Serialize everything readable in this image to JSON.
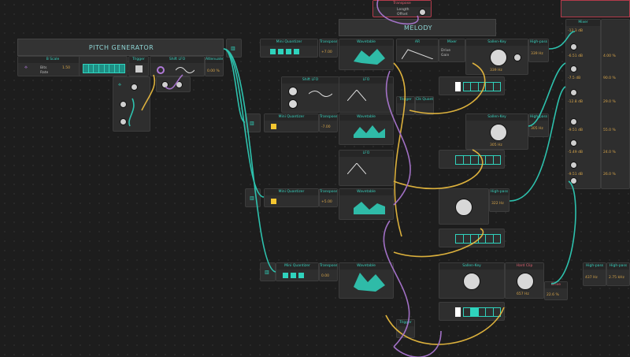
{
  "groups": {
    "pitch_generator": "PITCH GENERATOR",
    "melody": "MELODY"
  },
  "modules": {
    "bitrate": "B Scale",
    "trigger": "Trigger",
    "lfo_top": "Shift LFO",
    "attenuate": "Attenuate",
    "transpose_top": "Transpose",
    "transpose_red": "Transpose",
    "mini_quantizer": "Mini Quantizer",
    "transpose": "Transpose",
    "wavetable": "Wavetable",
    "ar": "AR",
    "mixer": "Mixer",
    "sallen_key": "Sallen-Key",
    "high_pass": "High-pass",
    "mixer_right": "Mixer",
    "hard_clip": "Hard Clip",
    "cb_quant": "Clk Quant",
    "trigger_small": "Trigger",
    "mod_lfo": "Shift LFO",
    "lfo": "LFO",
    "drive": "Drive",
    "comb": "Combo"
  },
  "labels": {
    "length": "Length",
    "offset": "Offset",
    "bits": "Bits",
    "rate": "Rate",
    "gain": "Gain",
    "drive": "Drive",
    "bipolar": "Bipolar",
    "sine": "Sine"
  },
  "values": {
    "hp_top": "339 Hz",
    "hp2": "305 Hz",
    "hp3": "322 Hz",
    "sk_low": "339 Hz",
    "sk_mid": "305 Hz",
    "sk_bot": "657 Hz",
    "mix_r1": "-12.3 dB",
    "mix_r2": "-6.51 dB",
    "mix_r3": "-7.5 dB",
    "mix_r4": "-12.8 dB",
    "mix_r5": "-9.51 dB",
    "mix_r6": "-5.49 dB",
    "mix_r7": "-9.51 dB",
    "mix_r8": "-6.50 dB",
    "pct1": "0.00 %",
    "pct2": "4.00 %",
    "pct3": "90.0 %",
    "pct4": "29.0 %",
    "pct5": "55.0 %",
    "pct6": "24.0 %",
    "pct7": "26.0 %",
    "tr1": "+7.00",
    "tr2": "-7.00",
    "tr3": "+5.00",
    "tr4": "0.00",
    "hz_a": "437 Hz",
    "hz_b": "657 Hz",
    "hz_c": "22.6 %",
    "last": "2.75 kHz"
  }
}
